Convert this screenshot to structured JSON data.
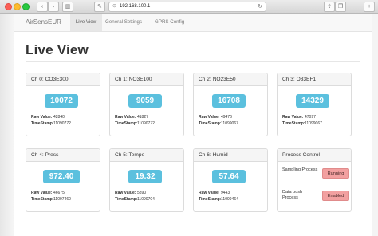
{
  "browser": {
    "url": "192.168.100.1"
  },
  "navbar": {
    "brand": "AirSensEUR",
    "tabs": [
      {
        "label": "Live View"
      },
      {
        "label": "General Settings"
      },
      {
        "label": "GPRS Config"
      }
    ]
  },
  "page": {
    "title": "Live View"
  },
  "channels": [
    {
      "name": "Ch 0: CO3E300",
      "value": "10072",
      "raw_label": "Raw Value:",
      "raw": "42840",
      "ts_label": "TimeStamp:",
      "timestamp": "11090772"
    },
    {
      "name": "Ch 1: NO3E100",
      "value": "9059",
      "raw_label": "Raw Value:",
      "raw": "41827",
      "ts_label": "TimeStamp:",
      "timestamp": "11090772"
    },
    {
      "name": "Ch 2: NO23E50",
      "value": "16708",
      "raw_label": "Raw Value:",
      "raw": "49476",
      "ts_label": "TimeStamp:",
      "timestamp": "11099067"
    },
    {
      "name": "Ch 3: O33EF1",
      "value": "14329",
      "raw_label": "Raw Value:",
      "raw": "47097",
      "ts_label": "TimeStamp:",
      "timestamp": "11099067"
    },
    {
      "name": "Ch 4: Press",
      "value": "972.40",
      "raw_label": "Raw Value:",
      "raw": "46675",
      "ts_label": "TimeStamp:",
      "timestamp": "11097460"
    },
    {
      "name": "Ch 5: Tempe",
      "value": "19.32",
      "raw_label": "Raw Value:",
      "raw": "5890",
      "ts_label": "TimeStamp:",
      "timestamp": "11090704"
    },
    {
      "name": "Ch 6: Humid",
      "value": "57.64",
      "raw_label": "Raw Value:",
      "raw": "9443",
      "ts_label": "TimeStamp:",
      "timestamp": "11099464"
    }
  ],
  "process_control": {
    "title": "Process Control",
    "sampling_label": "Sampling Process",
    "sampling_status": "Running",
    "datapush_label": "Data push Process",
    "datapush_status": "Enabled"
  },
  "colors": {
    "badge": "#5bc0de",
    "status_button": "#f2a0a0"
  }
}
